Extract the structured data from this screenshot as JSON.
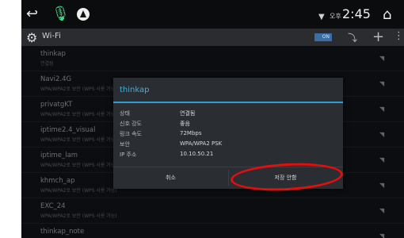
{
  "status_bar": {
    "icons": [
      "back-icon",
      "mic-icon",
      "navigation-icon",
      "wifi-icon",
      "home-icon"
    ],
    "ampm": "오후",
    "time": "2:45"
  },
  "action_bar": {
    "title": "Wi-Fi",
    "toggle_label": "ON",
    "icons": [
      "settings-gear-icon",
      "wps-icon",
      "add-icon",
      "more-icon"
    ]
  },
  "networks": [
    {
      "ssid": "thinkap",
      "sub": "연결됨"
    },
    {
      "ssid": "Navi2.4G",
      "sub": "WPA/WPA2로 보안 (WPS 사용 가능)"
    },
    {
      "ssid": "privatgKT",
      "sub": "WPA/WPA2로 보안 (WPS 사용 가능)"
    },
    {
      "ssid": "iptime2.4_visual",
      "sub": "WPA/WPA2로 보안 (WPS 사용 가능)"
    },
    {
      "ssid": "iptime_lam",
      "sub": "WPA/WPA2로 보안 (WPS 사용 가능)"
    },
    {
      "ssid": "khmch_ap",
      "sub": "WPA/WPA2로 보안 (WPS 사용 가능)"
    },
    {
      "ssid": "EXC_24",
      "sub": "WPA/WPA2로 보안 (WPS 사용 가능)"
    },
    {
      "ssid": "thinkap_note",
      "sub": ""
    }
  ],
  "dialog": {
    "title": "thinkap",
    "rows": [
      {
        "label": "상태",
        "value": "연결됨"
      },
      {
        "label": "신호 강도",
        "value": "좋음"
      },
      {
        "label": "링크 속도",
        "value": "72Mbps"
      },
      {
        "label": "보안",
        "value": "WPA/WPA2 PSK"
      },
      {
        "label": "IP 주소",
        "value": "10.10.50.21"
      }
    ],
    "cancel_label": "취소",
    "save_label": "저장 안함"
  },
  "colors": {
    "accent": "#37b5e6",
    "annotation": "#e01010"
  }
}
